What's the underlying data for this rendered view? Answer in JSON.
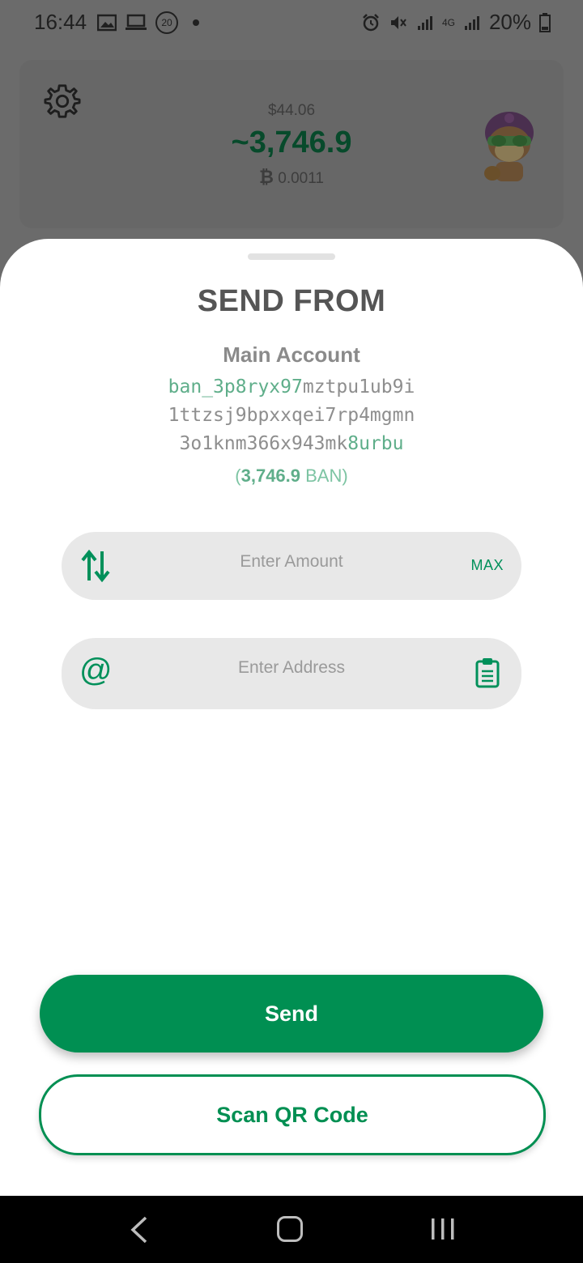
{
  "status_bar": {
    "time": "16:44",
    "left_icons": [
      "image-icon",
      "laptop-icon",
      "notification-20-icon",
      "dot-icon"
    ],
    "notification_count": "20",
    "battery": "20%",
    "network": "4G"
  },
  "header": {
    "fiat_value": "$44.06",
    "balance": "~3,746.9",
    "btc_value": "0.0011",
    "settings_icon": "gear-icon",
    "avatar_icon": "monkey-avatar"
  },
  "sheet": {
    "title": "SEND FROM",
    "account_name": "Main Account",
    "address": {
      "line1_highlight": "ban_3p8ryx97",
      "line1_rest": "mztpu1ub9i",
      "line2": "1ttzsj9bpxxqei7rp4mgmn",
      "line3_start": "3o1knm366x943mk",
      "line3_highlight": "8urbu"
    },
    "account_balance": {
      "open": "(",
      "amount": "3,746.9",
      "unit": " BAN",
      "close": ")"
    },
    "amount_field": {
      "placeholder": "Enter Amount",
      "max_label": "MAX",
      "icon": "swap-arrows-icon"
    },
    "address_field": {
      "placeholder": "Enter Address",
      "at_symbol": "@",
      "icon": "clipboard-icon"
    },
    "send_label": "Send",
    "scan_label": "Scan QR Code"
  },
  "colors": {
    "accent": "#008f52",
    "address_highlight": "#5fae8a",
    "field_bg": "#e8e8e8",
    "title": "#555555"
  }
}
